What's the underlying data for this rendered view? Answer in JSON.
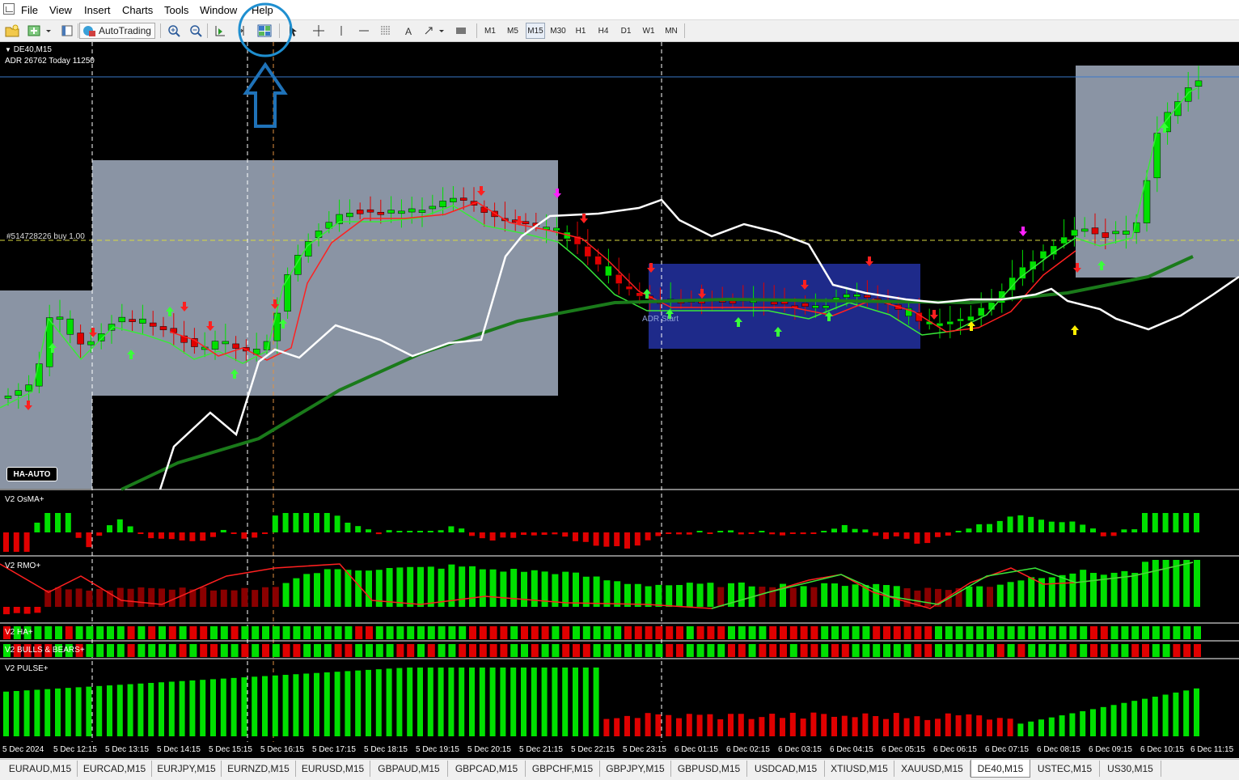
{
  "menu": [
    "File",
    "View",
    "Insert",
    "Charts",
    "Tools",
    "Window",
    "Help"
  ],
  "toolbar": {
    "autotrading_label": "AutoTrading",
    "timeframes": [
      "M1",
      "M5",
      "M15",
      "M30",
      "H1",
      "H4",
      "D1",
      "W1",
      "MN"
    ],
    "active_timeframe": "M15"
  },
  "chart": {
    "symbol": "DE40,M15",
    "adr_text": "ADR 26762  Today 11250",
    "order_label": "#514728226 buy 1.00",
    "adr_start_label": "ADR Start",
    "ha_auto_label": "HA-AUTO",
    "colors": {
      "bull": "#00e000",
      "bear": "#e00000",
      "box": "#8a94a4",
      "adr_box": "#1e2a8a",
      "ema_fast": "#39e839",
      "ma_red": "#ff2020",
      "ma_slow": "#1a7a1a",
      "white_line": "#ffffff"
    },
    "subwindows": [
      "V2 OsMA+",
      "V2 RMO+",
      "V2 HA+",
      "V2 BULLS & BEARS+",
      "V2 PULSE+"
    ],
    "time_axis": [
      "5 Dec 2024",
      "5 Dec 12:15",
      "5 Dec 13:15",
      "5 Dec 14:15",
      "5 Dec 15:15",
      "5 Dec 16:15",
      "5 Dec 17:15",
      "5 Dec 18:15",
      "5 Dec 19:15",
      "5 Dec 20:15",
      "5 Dec 21:15",
      "5 Dec 22:15",
      "5 Dec 23:15",
      "6 Dec 01:15",
      "6 Dec 02:15",
      "6 Dec 03:15",
      "6 Dec 04:15",
      "6 Dec 05:15",
      "6 Dec 06:15",
      "6 Dec 07:15",
      "6 Dec 08:15",
      "6 Dec 09:15",
      "6 Dec 10:15",
      "6 Dec 11:15"
    ]
  },
  "tabs": [
    "EURAUD,M15",
    "EURCAD,M15",
    "EURJPY,M15",
    "EURNZD,M15",
    "EURUSD,M15",
    "GBPAUD,M15",
    "GBPCAD,M15",
    "GBPCHF,M15",
    "GBPJPY,M15",
    "GBPUSD,M15",
    "USDCAD,M15",
    "XTIUSD,M15",
    "XAUUSD,M15",
    "DE40,M15",
    "USTEC,M15",
    "US30,M15"
  ],
  "active_tab": "DE40,M15"
}
